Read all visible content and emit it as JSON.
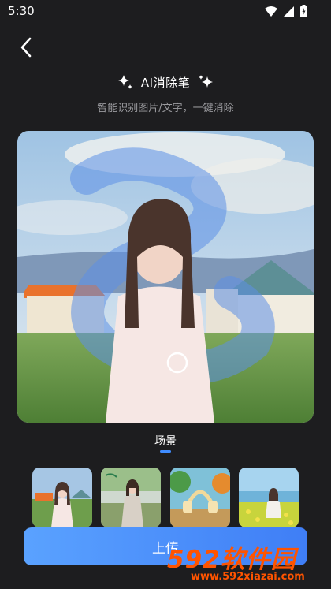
{
  "status_bar": {
    "time": "5:30"
  },
  "header": {
    "title": "AI消除笔",
    "subtitle": "智能识别图片/文字，一键消除"
  },
  "tab": {
    "label": "场景"
  },
  "thumbnails": [
    {
      "name": "girl-grass-scene"
    },
    {
      "name": "girl-outdoor-scene"
    },
    {
      "name": "headphones-product-scene"
    },
    {
      "name": "flower-field-scene"
    }
  ],
  "upload_button": {
    "label": "上传"
  },
  "watermark": {
    "logo": "592软件园",
    "url": "www.592xiazai.com"
  },
  "colors": {
    "accent": "#3f8cff",
    "background": "#1d1d1f",
    "watermark": "#ff5400"
  }
}
